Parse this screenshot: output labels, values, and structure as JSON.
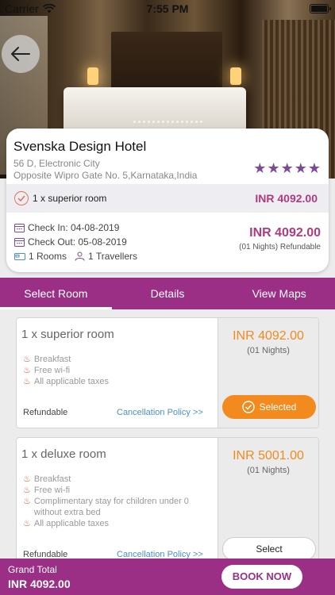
{
  "status_bar": {
    "carrier": "Carrier",
    "time": "7:55 PM"
  },
  "hero": {
    "image": "hotel-room-photo"
  },
  "hotel": {
    "name": "Svenska Design Hotel",
    "address_line1": "56 D, Electronic City",
    "address_line2": "Opposite Wipro Gate No. 5,Karnataka,India",
    "rating": 5,
    "selected_room_label": "1 x superior room",
    "selected_room_price": "INR 4092.00",
    "check_in": "Check In: 04-08-2019",
    "check_out": "Check Out: 05-08-2019",
    "rooms": "1 Rooms",
    "travellers": "1 Travellers",
    "total_price": "INR 4092.00",
    "nights_refund": "(01 Nights) Refundable"
  },
  "tabs": [
    {
      "label": "Select Room",
      "active": true
    },
    {
      "label": "Details",
      "active": false
    },
    {
      "label": "View Maps",
      "active": false
    }
  ],
  "rooms": [
    {
      "title": "1 x superior room",
      "amenities": [
        "Breakfast",
        "Free wi-fi",
        "All applicable taxes"
      ],
      "refund": "Refundable",
      "policy_link": "Cancellation Policy >>",
      "price": "INR 4092.00",
      "nights": "(01 Nights)",
      "button": "Selected"
    },
    {
      "title": "1 x deluxe room",
      "amenities": [
        "Breakfast",
        "Free wi-fi",
        "Complimentary stay for children under 0 without extra bed",
        "All applicable taxes"
      ],
      "refund": "Refundable",
      "policy_link": "Cancellation Policy >>",
      "price": "INR 5001.00",
      "nights": "(01 Nights)",
      "button": "Select"
    }
  ],
  "footer": {
    "grand_total_label": "Grand Total",
    "grand_total_value": "INR 4092.00",
    "book_button": "BOOK NOW"
  },
  "colors": {
    "brand": "#9b2f86",
    "price": "#b03a7e",
    "accent": "#f28a1e",
    "link": "#4a90c8"
  }
}
